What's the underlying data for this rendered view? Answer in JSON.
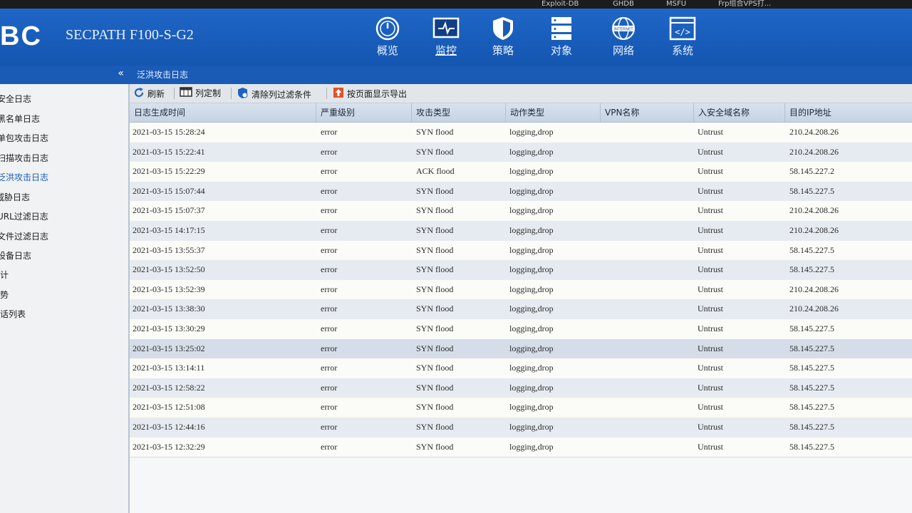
{
  "browser_bar": [
    "Exploit-DB",
    "GHDB",
    "MSFU",
    "Frp组合VPS打..."
  ],
  "header": {
    "logo": "BC",
    "product": "SECPATH F100-S-G2",
    "nav": [
      {
        "label": "概览",
        "icon": "dashboard-icon"
      },
      {
        "label": "监控",
        "icon": "monitor-icon"
      },
      {
        "label": "策略",
        "icon": "shield-icon"
      },
      {
        "label": "对象",
        "icon": "server-icon"
      },
      {
        "label": "网络",
        "icon": "internet-icon"
      },
      {
        "label": "系统",
        "icon": "code-icon"
      }
    ],
    "active_nav": "监控"
  },
  "sidebar": {
    "collapse_glyph": "«",
    "items": [
      "安全日志",
      "黑名单日志",
      "单包攻击日志",
      "扫描攻击日志",
      "泛洪攻击日志",
      "威胁日志",
      "URL过滤日志",
      "文件过滤日志",
      "设备日志",
      "统计",
      "趋势",
      "会话列表"
    ],
    "active_index": 4
  },
  "breadcrumb": "泛洪攻击日志",
  "toolbar": {
    "refresh": "刷新",
    "columns": "列定制",
    "clear_filter": "清除列过滤条件",
    "export": "按页面显示导出"
  },
  "table": {
    "columns": [
      "日志生成时间",
      "严重级别",
      "攻击类型",
      "动作类型",
      "VPN名称",
      "入安全域名称",
      "目的IP地址"
    ],
    "rows": [
      [
        "2021-03-15 15:28:24",
        "error",
        "SYN flood",
        "logging,drop",
        "",
        "Untrust",
        "210.24.208.26"
      ],
      [
        "2021-03-15 15:22:41",
        "error",
        "SYN flood",
        "logging,drop",
        "",
        "Untrust",
        "210.24.208.26"
      ],
      [
        "2021-03-15 15:22:29",
        "error",
        "ACK flood",
        "logging,drop",
        "",
        "Untrust",
        "58.145.227.2"
      ],
      [
        "2021-03-15 15:07:44",
        "error",
        "SYN flood",
        "logging,drop",
        "",
        "Untrust",
        "58.145.227.5"
      ],
      [
        "2021-03-15 15:07:37",
        "error",
        "SYN flood",
        "logging,drop",
        "",
        "Untrust",
        "210.24.208.26"
      ],
      [
        "2021-03-15 14:17:15",
        "error",
        "SYN flood",
        "logging,drop",
        "",
        "Untrust",
        "210.24.208.26"
      ],
      [
        "2021-03-15 13:55:37",
        "error",
        "SYN flood",
        "logging,drop",
        "",
        "Untrust",
        "58.145.227.5"
      ],
      [
        "2021-03-15 13:52:50",
        "error",
        "SYN flood",
        "logging,drop",
        "",
        "Untrust",
        "58.145.227.5"
      ],
      [
        "2021-03-15 13:52:39",
        "error",
        "SYN flood",
        "logging,drop",
        "",
        "Untrust",
        "210.24.208.26"
      ],
      [
        "2021-03-15 13:38:30",
        "error",
        "SYN flood",
        "logging,drop",
        "",
        "Untrust",
        "210.24.208.26"
      ],
      [
        "2021-03-15 13:30:29",
        "error",
        "SYN flood",
        "logging,drop",
        "",
        "Untrust",
        "58.145.227.5"
      ],
      [
        "2021-03-15 13:25:02",
        "error",
        "SYN flood",
        "logging,drop",
        "",
        "Untrust",
        "58.145.227.5"
      ],
      [
        "2021-03-15 13:14:11",
        "error",
        "SYN flood",
        "logging,drop",
        "",
        "Untrust",
        "58.145.227.5"
      ],
      [
        "2021-03-15 12:58:22",
        "error",
        "SYN flood",
        "logging,drop",
        "",
        "Untrust",
        "58.145.227.5"
      ],
      [
        "2021-03-15 12:51:08",
        "error",
        "SYN flood",
        "logging,drop",
        "",
        "Untrust",
        "58.145.227.5"
      ],
      [
        "2021-03-15 12:44:16",
        "error",
        "SYN flood",
        "logging,drop",
        "",
        "Untrust",
        "58.145.227.5"
      ],
      [
        "2021-03-15 12:32:29",
        "error",
        "SYN flood",
        "logging,drop",
        "",
        "Untrust",
        "58.145.227.5"
      ]
    ],
    "selected_row": 11
  },
  "colors": {
    "header_blue": "#1a5bb5",
    "accent_icon_red": "#e0502a"
  }
}
